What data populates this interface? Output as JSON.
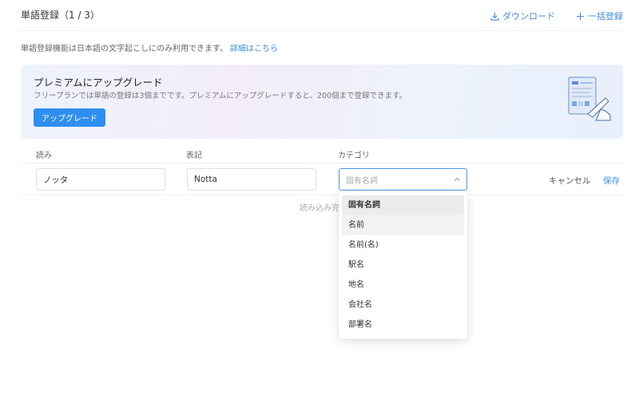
{
  "header": {
    "title": "単語登録（1 / 3）",
    "download_label": "ダウンロード",
    "bulk_register_label": "一括登録"
  },
  "notice": {
    "text": "単語登録機能は日本語の文字起こしにのみ利用できます。",
    "link": "詳細はこちら"
  },
  "banner": {
    "title": "プレミアムにアップグレード",
    "description": "フリープランでは単語の登録は3個までです。プレミアムにアップグレードすると、200個まで登録できます。",
    "button_label": "アップグレード"
  },
  "form": {
    "columns": {
      "reading": "読み",
      "notation": "表記",
      "category": "カテゴリ"
    },
    "reading_value": "ノッタ",
    "notation_value": "Notta",
    "category_placeholder": "固有名詞",
    "cancel_label": "キャンセル",
    "save_label": "保存",
    "loading_text": "読み込み完"
  },
  "dropdown": {
    "options": [
      "固有名詞",
      "名前",
      "名前(名)",
      "駅名",
      "地名",
      "会社名",
      "部署名"
    ],
    "selected_index": 0,
    "hover_index": 1
  },
  "colors": {
    "accent": "#3a8ee6",
    "button": "#2f8ff0"
  }
}
